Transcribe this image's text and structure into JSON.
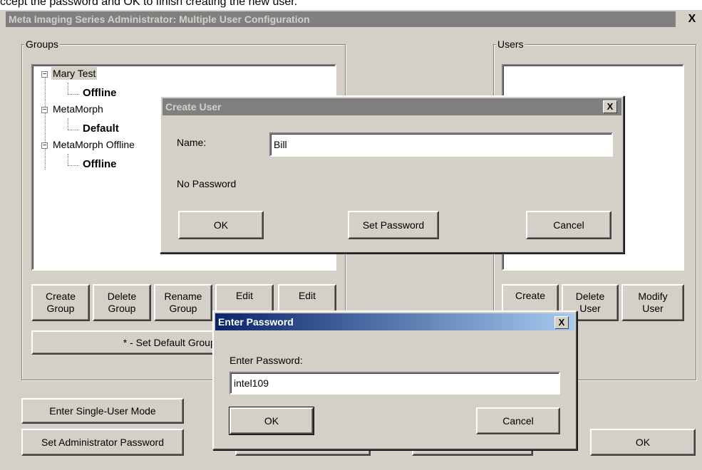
{
  "caption": "ccept the password and OK to finish creating the new user.",
  "main_window": {
    "title": "Meta Imaging Series Administrator: Multiple User Configuration",
    "close_label": "X",
    "groups_label": "Groups",
    "users_label": "Users",
    "tree": [
      {
        "group": "Mary Test",
        "child": "Offline",
        "expander": "−"
      },
      {
        "group": "MetaMorph",
        "child": "Default",
        "expander": "−"
      },
      {
        "group": "MetaMorph Offline",
        "child": "Offline",
        "expander": "−"
      }
    ],
    "group_buttons": [
      "Create\nGroup",
      "Delete\nGroup",
      "Rename\nGroup",
      "Edit",
      "Edit"
    ],
    "set_default_label": "* - Set Default Group And F",
    "user_buttons": [
      "Create",
      "Delete\nUser",
      "Modify\nUser"
    ],
    "single_user_label": "Enter Single-User Mode",
    "admin_password_label": "Set Administrator Password",
    "ok_label": "OK"
  },
  "create_user": {
    "title": "Create User",
    "close_label": "X",
    "name_label": "Name:",
    "name_value": "Bill",
    "password_status": "No Password",
    "ok_label": "OK",
    "set_password_label": "Set Password",
    "cancel_label": "Cancel"
  },
  "enter_password": {
    "title": "Enter Password",
    "close_label": "X",
    "prompt": "Enter Password:",
    "value": "intel109",
    "ok_label": "OK",
    "cancel_label": "Cancel"
  }
}
